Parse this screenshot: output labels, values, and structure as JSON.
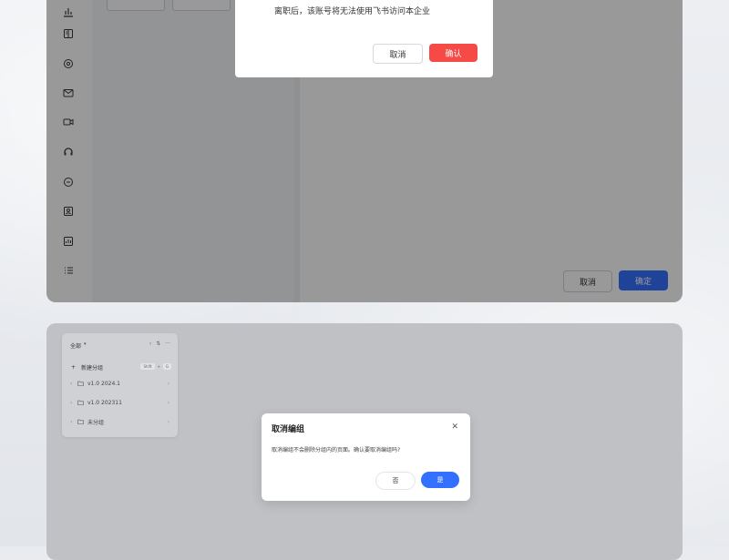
{
  "top_confirm_dialog": {
    "message": "离职后，该账号将无法使用飞书访问本企业",
    "cancel_label": "取消",
    "confirm_label": "确认"
  },
  "top_footer": {
    "cancel_label": "取消",
    "ok_label": "确定"
  },
  "sidebar_icons": [
    "chart-icon",
    "book-icon",
    "gear-icon",
    "mail-icon",
    "video-icon",
    "headset-icon",
    "chat-icon",
    "contact-icon",
    "report-icon",
    "list-icon"
  ],
  "group_card": {
    "title": "全部",
    "new_group_label": "新建分组",
    "items": [
      {
        "label": "v1.0 2024.1"
      },
      {
        "label": "v1.0 202311"
      },
      {
        "label": "未分组"
      }
    ]
  },
  "cancel_group_dialog": {
    "title": "取消编组",
    "body": "取消编组不会删除分组内的页面。确认要取消编组吗?",
    "no_label": "否",
    "yes_label": "是"
  },
  "colors": {
    "accent_blue": "#3370ff",
    "danger_red": "#f54a45"
  }
}
